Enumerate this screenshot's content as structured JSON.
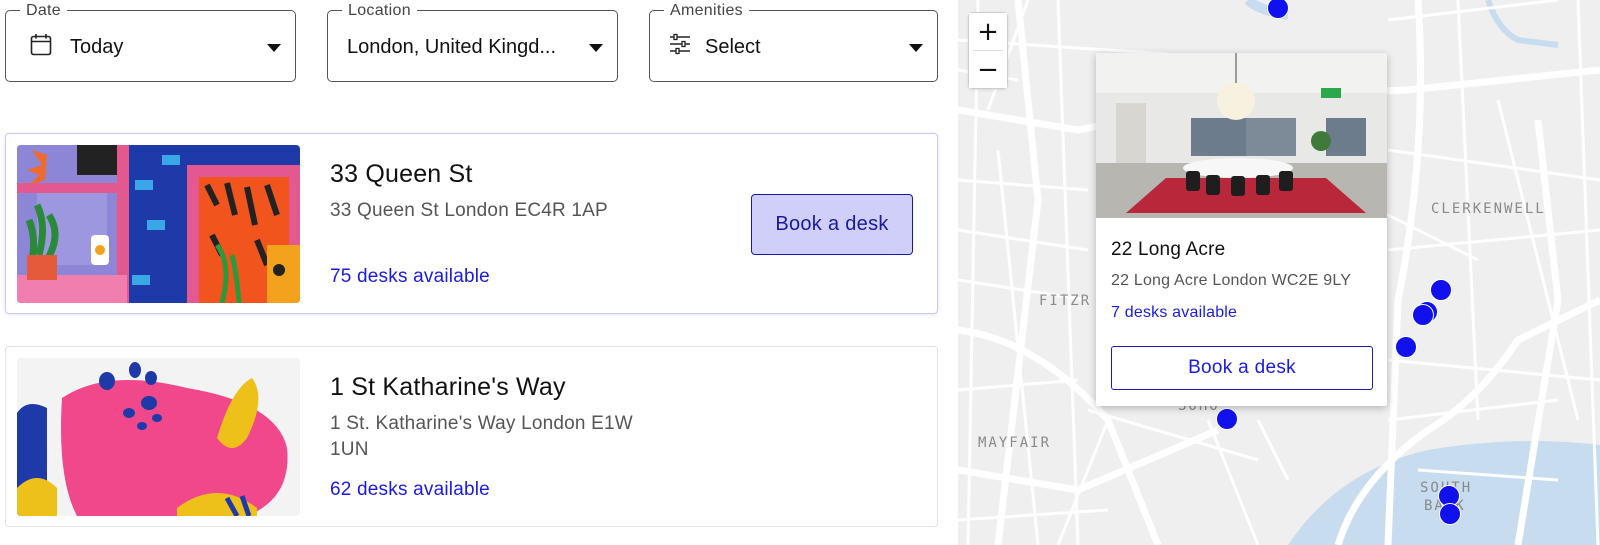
{
  "filters": {
    "date": {
      "legend": "Date",
      "value": "Today",
      "icon": "calendar-icon"
    },
    "location": {
      "legend": "Location",
      "value": "London, United Kingd..."
    },
    "amenities": {
      "legend": "Amenities",
      "value": "Select",
      "icon": "sliders-icon"
    }
  },
  "listings": [
    {
      "name": "33 Queen St",
      "address": "33 Queen St London EC4R 1AP",
      "availability": "75 desks available",
      "button_label": "Book a desk",
      "selected": true
    },
    {
      "name": "1 St Katharine's Way",
      "address": "1 St. Katharine's Way London E1W 1UN",
      "availability": "62 desks available"
    }
  ],
  "map": {
    "zoom_in": "+",
    "zoom_out": "−",
    "labels": {
      "clerkenwell": "CLERKENWELL",
      "fitzrovia": "FITZR",
      "mayfair": "MAYFAIR",
      "soho": "SOHO",
      "south": "SOUTH",
      "bank": "BANK"
    },
    "popup": {
      "name": "22 Long Acre",
      "address": "22 Long Acre London WC2E 9LY",
      "availability": "7 desks available",
      "button_label": "Book a desk"
    },
    "marker_color": "#1111ee"
  },
  "colors": {
    "accent": "#1a1ae6",
    "button_fill": "#cfcffa",
    "river": "#c8dcef",
    "map_bg": "#efefef"
  }
}
